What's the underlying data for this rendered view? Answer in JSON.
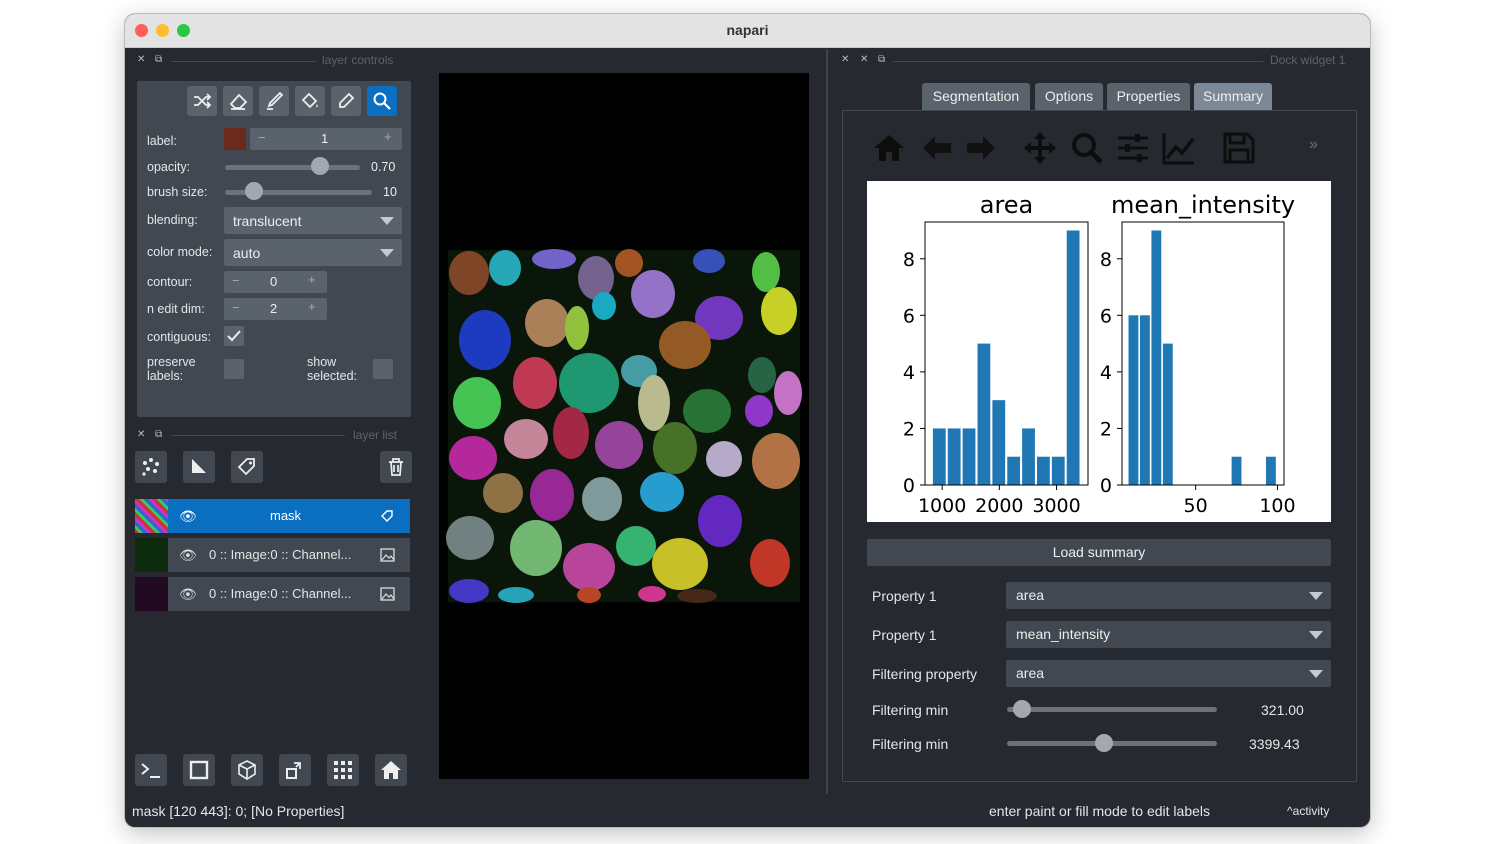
{
  "window": {
    "title": "napari"
  },
  "layer_controls": {
    "header": "layer controls",
    "label_label": "label:",
    "label_value": "1",
    "label_color": "#6b2a1e",
    "opacity_label": "opacity:",
    "opacity_value": "0.70",
    "opacity_fraction": 0.7,
    "brush_label": "brush size:",
    "brush_value": "10",
    "brush_fraction": 0.2,
    "blending_label": "blending:",
    "blending_value": "translucent",
    "colormode_label": "color mode:",
    "colormode_value": "auto",
    "contour_label": "contour:",
    "contour_value": "0",
    "nedit_label": "n edit dim:",
    "nedit_value": "2",
    "contiguous_label": "contiguous:",
    "preserve_label_1": "preserve",
    "preserve_label_2": "labels:",
    "show_label_1": "show",
    "show_label_2": "selected:",
    "minus": "−",
    "plus": "+"
  },
  "layer_list": {
    "header": "layer list",
    "layers": [
      {
        "name": "mask",
        "selected": true
      },
      {
        "name": "0 :: Image:0 :: Channel...",
        "selected": false
      },
      {
        "name": "0 :: Image:0 :: Channel...",
        "selected": false
      }
    ]
  },
  "dock": {
    "header": "Dock widget 1",
    "tabs": [
      "Segmentation",
      "Options",
      "Properties",
      "Summary"
    ],
    "active_tab": "Summary",
    "more_glyph": "»",
    "load_summary": "Load summary",
    "property1_label": "Property 1",
    "property1_value": "area",
    "property2_label": "Property 1",
    "property2_value": "mean_intensity",
    "filter_prop_label": "Filtering property",
    "filter_prop_value": "area",
    "filter_min1_label": "Filtering min",
    "filter_min1_value": "321.00",
    "filter_min1_fraction": 0.07,
    "filter_min2_label": "Filtering min",
    "filter_min2_value": "3399.43",
    "filter_min2_fraction": 0.46
  },
  "status": {
    "left": "mask [120 443]: 0; [No Properties]",
    "right": "enter paint or fill mode to edit labels",
    "activity": "activity"
  },
  "colors": {
    "accent": "#0a6fc1",
    "bar": "#1f77b4"
  },
  "chart_data": [
    {
      "type": "bar",
      "title": "area",
      "x": [
        950,
        1210,
        1470,
        1730,
        1990,
        2250,
        2510,
        2770,
        3030,
        3290
      ],
      "values": [
        2,
        2,
        2,
        5,
        3,
        1,
        2,
        1,
        1,
        9
      ],
      "xticks": [
        "1000",
        "2000",
        "3000"
      ],
      "xtick_values": [
        1000,
        2000,
        3000
      ],
      "yticks": [
        "0",
        "2",
        "4",
        "6",
        "8"
      ],
      "ytick_values": [
        0,
        2,
        4,
        6,
        8
      ],
      "xlim": [
        700,
        3550
      ],
      "ylim": [
        0,
        9.3
      ]
    },
    {
      "type": "bar",
      "title": "mean_intensity",
      "x": [
        12,
        19,
        26,
        33,
        40,
        47,
        54,
        61,
        68,
        75,
        82,
        89,
        96
      ],
      "values": [
        6,
        6,
        9,
        5,
        0,
        0,
        0,
        0,
        0,
        1,
        0,
        0,
        1
      ],
      "xticks": [
        "50",
        "100"
      ],
      "xtick_values": [
        50,
        100
      ],
      "yticks": [
        "0",
        "2",
        "4",
        "6",
        "8"
      ],
      "ytick_values": [
        0,
        2,
        4,
        6,
        8
      ],
      "xlim": [
        5,
        104
      ],
      "ylim": [
        0,
        9.3
      ]
    }
  ]
}
